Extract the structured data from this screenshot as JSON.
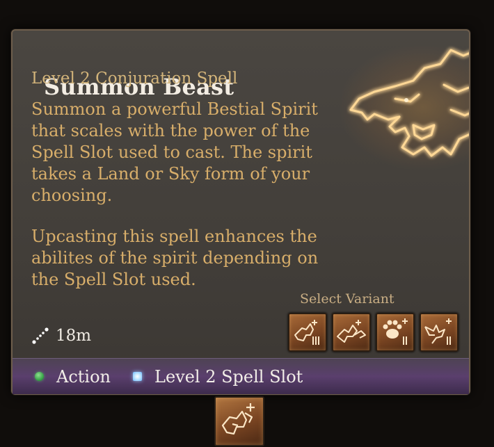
{
  "spell": {
    "title": "Summon Beast",
    "subtitle": "Level 2 Conjuration Spell",
    "description": "Summon a powerful Bestial Spirit that scales with the power of the Spell Slot used to cast. The spirit takes a Land or Sky form of your choosing.",
    "upcast": "Upcasting this spell enhances the abilites of the spirit depending on the Spell Slot used.",
    "range": "18m",
    "art_icon": "wolf-head-glow-icon"
  },
  "variants": {
    "label": "Select Variant",
    "items": [
      {
        "icon": "wolf-land-variant-icon"
      },
      {
        "icon": "wolf-sky-variant-icon"
      },
      {
        "icon": "paw-variant-icon"
      },
      {
        "icon": "eagle-variant-icon"
      }
    ]
  },
  "costs": {
    "action_label": "Action",
    "slot_label": "Level 2 Spell Slot",
    "action_color": "#3aa64a",
    "slot_color": "#bfe6ff"
  },
  "hotbar": {
    "icon": "summon-beast-wolf-icon"
  },
  "colors": {
    "panel": "#45413c",
    "title": "#f3ede3",
    "subtitle": "#d3b47a",
    "body": "#d8ae6a",
    "cost_bar": "#5a3f6d"
  }
}
